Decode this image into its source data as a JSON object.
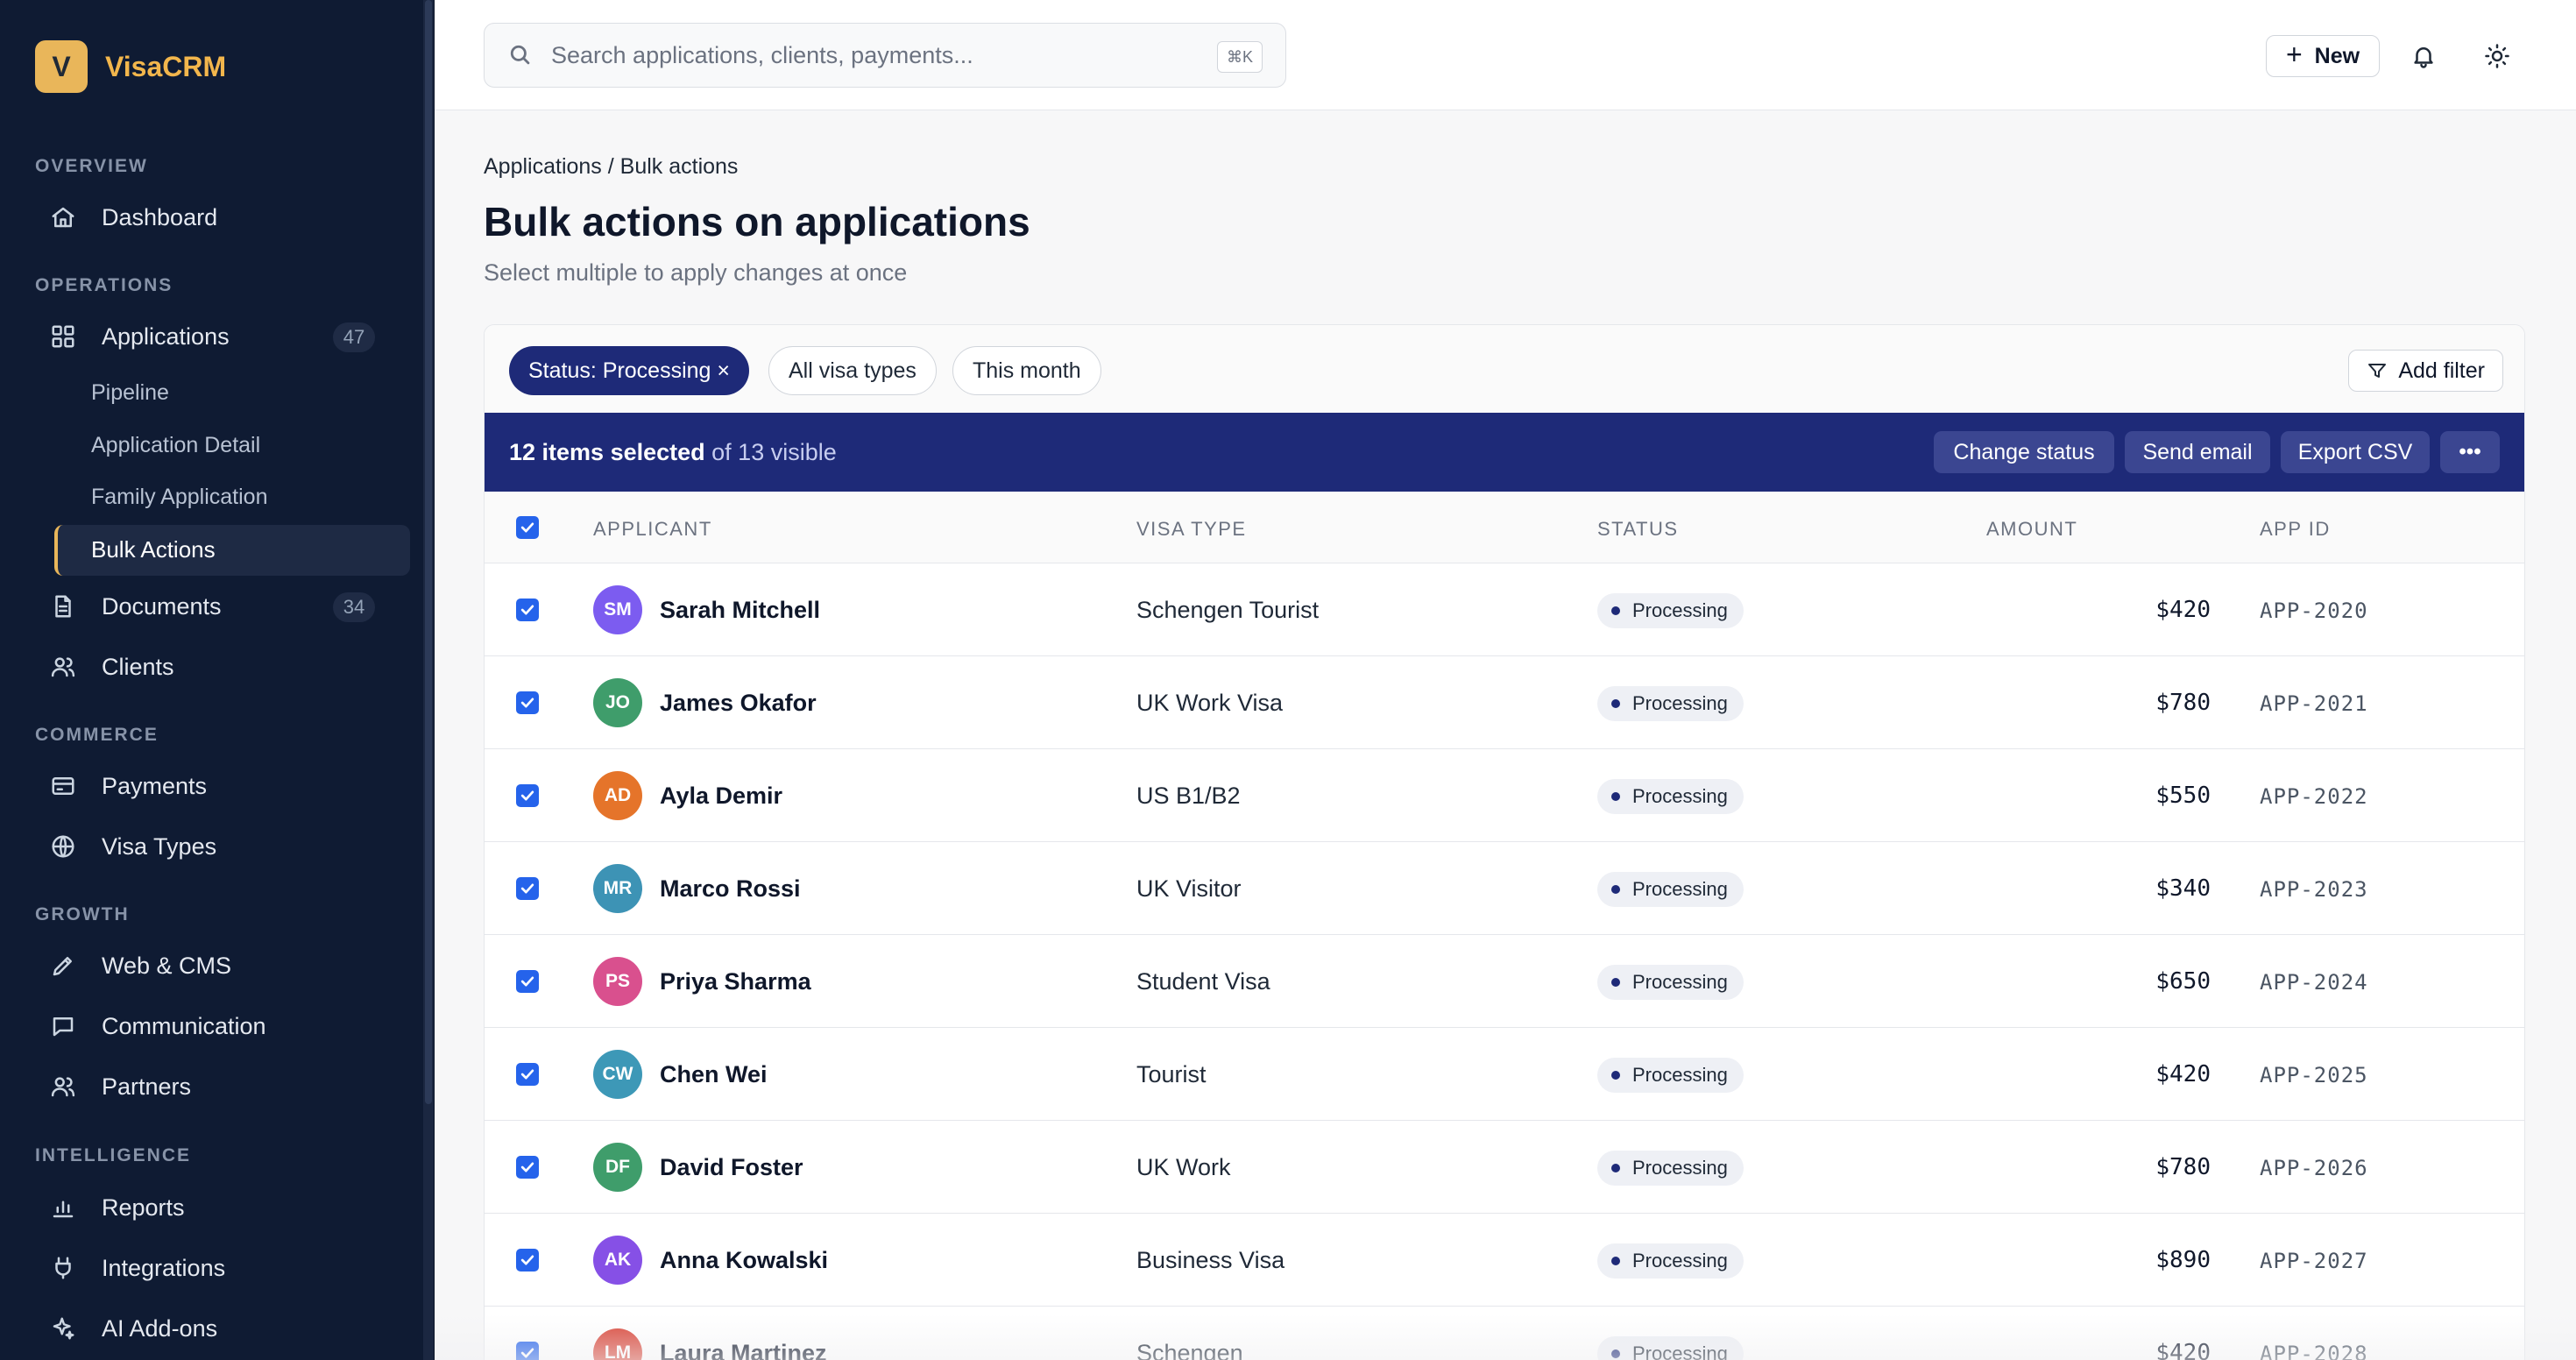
{
  "brand": {
    "logo_letter": "V",
    "name": "VisaCRM",
    "accent": "#e9b65a"
  },
  "sidebar": {
    "sections": {
      "overview": "OVERVIEW",
      "operations": "OPERATIONS",
      "commerce": "COMMERCE",
      "growth": "GROWTH",
      "intelligence": "INTELLIGENCE"
    },
    "items": {
      "dashboard": {
        "label": "Dashboard",
        "icon": "home-icon"
      },
      "applications": {
        "label": "Applications",
        "badge": "47",
        "icon": "grid-icon"
      },
      "documents": {
        "label": "Documents",
        "badge": "34",
        "icon": "document-icon"
      },
      "clients": {
        "label": "Clients",
        "icon": "users-icon"
      },
      "payments": {
        "label": "Payments",
        "icon": "credit-card-icon"
      },
      "visa_types": {
        "label": "Visa Types",
        "icon": "globe-icon"
      },
      "web_cms": {
        "label": "Web & CMS",
        "icon": "pencil-icon"
      },
      "communication": {
        "label": "Communication",
        "icon": "message-icon"
      },
      "partners": {
        "label": "Partners",
        "icon": "users-icon"
      },
      "reports": {
        "label": "Reports",
        "icon": "bar-chart-icon"
      },
      "integrations": {
        "label": "Integrations",
        "icon": "plug-icon"
      },
      "ai_addons": {
        "label": "AI Add-ons",
        "icon": "sparkle-icon"
      }
    },
    "sub_items": {
      "pipeline": "Pipeline",
      "application_detail": "Application Detail",
      "family_application": "Family Application",
      "bulk_actions": "Bulk Actions"
    }
  },
  "topbar": {
    "search_placeholder": "Search applications, clients, payments...",
    "search_shortcut": "⌘K",
    "new_label": "New"
  },
  "page": {
    "breadcrumb": "Applications / Bulk actions",
    "title": "Bulk actions on applications",
    "subtitle": "Select multiple to apply changes at once"
  },
  "filters": {
    "active_chip": "Status: Processing ×",
    "chip_visa": "All visa types",
    "chip_date": "This month",
    "add_filter": "Add filter"
  },
  "selection": {
    "selected_text": "12 items selected",
    "visible_text": "of 13 visible",
    "actions": {
      "change_status": "Change status",
      "send_email": "Send email",
      "export_csv": "Export CSV",
      "more": "•••"
    }
  },
  "table": {
    "columns": {
      "applicant": "APPLICANT",
      "visa_type": "VISA TYPE",
      "status": "STATUS",
      "amount": "AMOUNT",
      "app_id": "APP ID"
    },
    "rows": [
      {
        "initials": "SM",
        "avatar_color": "#7c5cf0",
        "name": "Sarah Mitchell",
        "visa": "Schengen Tourist",
        "status": "Processing",
        "amount": "$420",
        "app_id": "APP-2020"
      },
      {
        "initials": "JO",
        "avatar_color": "#3f9d6b",
        "name": "James Okafor",
        "visa": "UK Work Visa",
        "status": "Processing",
        "amount": "$780",
        "app_id": "APP-2021"
      },
      {
        "initials": "AD",
        "avatar_color": "#e5742a",
        "name": "Ayla Demir",
        "visa": "US B1/B2",
        "status": "Processing",
        "amount": "$550",
        "app_id": "APP-2022"
      },
      {
        "initials": "MR",
        "avatar_color": "#3d93b5",
        "name": "Marco Rossi",
        "visa": "UK Visitor",
        "status": "Processing",
        "amount": "$340",
        "app_id": "APP-2023"
      },
      {
        "initials": "PS",
        "avatar_color": "#d9508e",
        "name": "Priya Sharma",
        "visa": "Student Visa",
        "status": "Processing",
        "amount": "$650",
        "app_id": "APP-2024"
      },
      {
        "initials": "CW",
        "avatar_color": "#3d98b7",
        "name": "Chen Wei",
        "visa": "Tourist",
        "status": "Processing",
        "amount": "$420",
        "app_id": "APP-2025"
      },
      {
        "initials": "DF",
        "avatar_color": "#3f9d6b",
        "name": "David Foster",
        "visa": "UK Work",
        "status": "Processing",
        "amount": "$780",
        "app_id": "APP-2026"
      },
      {
        "initials": "AK",
        "avatar_color": "#8650e6",
        "name": "Anna Kowalski",
        "visa": "Business Visa",
        "status": "Processing",
        "amount": "$890",
        "app_id": "APP-2027"
      },
      {
        "initials": "LM",
        "avatar_color": "#d9473a",
        "name": "Laura Martinez",
        "visa": "Schengen",
        "status": "Processing",
        "amount": "$420",
        "app_id": "APP-2028"
      }
    ]
  }
}
